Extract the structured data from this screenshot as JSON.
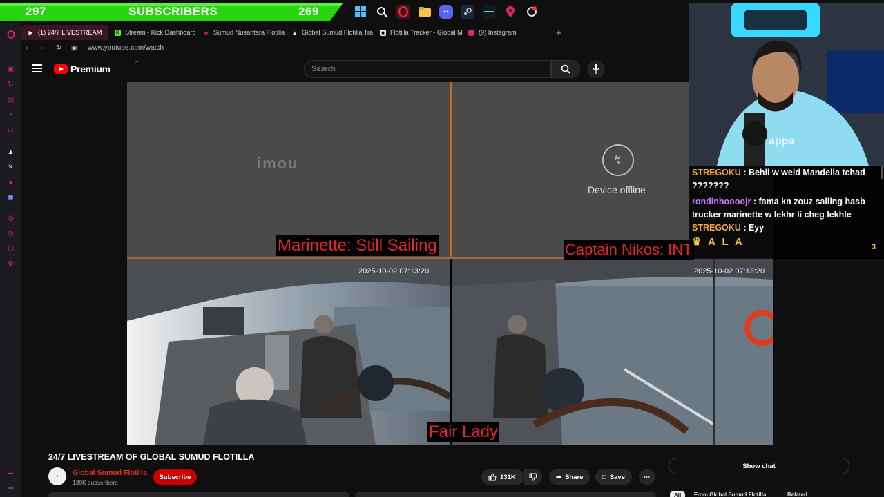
{
  "sub_bar": {
    "left_count": "297",
    "label": "SUBSCRIBERS",
    "right_count": "269"
  },
  "taskbar_icons": [
    "windows-icon",
    "search-icon",
    "opera-icon",
    "folder-icon",
    "discord-icon",
    "steam-icon",
    "terminal-icon",
    "maps-pin-icon",
    "settings-icon"
  ],
  "browser": {
    "tabs": [
      {
        "label": "(1) 24/7 LIVESTREAM",
        "active": true
      },
      {
        "label": "Stream - Kick Dashboard"
      },
      {
        "label": "Sumud Nusantara Flotilla"
      },
      {
        "label": "Global Sumud Flotilla Tra"
      },
      {
        "label": "Flotilla Tracker - Global M"
      },
      {
        "label": "(9) Instagram"
      }
    ],
    "new_tab": "+",
    "url": "www.youtube.com/watch"
  },
  "youtube": {
    "logo_word": "Premium",
    "logo_country": "IT",
    "search_placeholder": "Search"
  },
  "video": {
    "imou_logo": "imou",
    "offline_text": "Device offline",
    "label_marinette": "Marinette: Still Sailing",
    "label_nikos": "Captain Nikos: INT",
    "label_fairlady": "Fair Lady",
    "timestamp_left": "2025-10-02 07:13:20",
    "timestamp_right": "2025-10-02 07:13:20"
  },
  "chat": {
    "messages": [
      {
        "user": "STREGOKU",
        "text": " : Behii w weld Mandella tchad ???????"
      },
      {
        "user": "rondinhoooojr",
        "text": " : fama kn zouz sailing hasb trucker marinette w lekhr li cheg lekhle"
      },
      {
        "user": "STREGOKU",
        "text": " : Eyy"
      }
    ],
    "highlight": "A L A",
    "count": "3"
  },
  "below": {
    "title": "24/7 LIVESTREAM OF GLOBAL SUMUD FLOTILLA",
    "channel": "Global Sumud Flotilla",
    "subscribers": "139K subscribers",
    "subscribe": "Subscribe",
    "likes": "131K",
    "share": "Share",
    "save": "Save",
    "show_chat": "Show chat",
    "chips": [
      "All",
      "From Global Sumud Flotilla",
      "Related"
    ]
  },
  "colors": {
    "accent_red": "#cc0000",
    "sub_green": "#27d611",
    "opera_red": "#e0245e"
  }
}
